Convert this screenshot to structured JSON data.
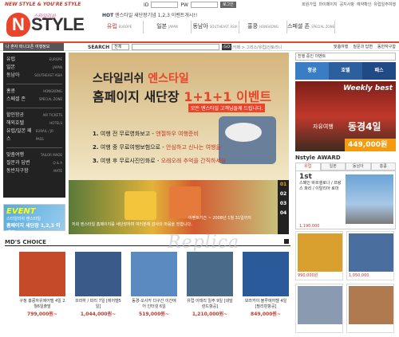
{
  "header": {
    "tagline": "NEW STYLE & YOU'RE STYLE",
    "id_label": "ID",
    "pw_label": "PW",
    "login_button": "로그인",
    "top_links": [
      "회원가입",
      "마이페이지",
      "공지사항",
      "예약확인",
      "유럽일주여행"
    ],
    "ticker_prefix": "HOT",
    "ticker": "엔스타일 새단장기념 1,2,3 이벤트개시!!"
  },
  "logo": {
    "mark": "N",
    "word": "STYLE",
    "small": "스타일리쉬"
  },
  "nav": {
    "tabs": [
      {
        "label": "유럽",
        "sub": "EUROPE"
      },
      {
        "label": "일본",
        "sub": "JAPAN"
      },
      {
        "label": "동남아",
        "sub": "SOUTHEAST ASIA"
      },
      {
        "label": "홍콩",
        "sub": "HONGKONG"
      },
      {
        "label": "스페셜 존",
        "sub": "SPECIAL ZONE"
      }
    ]
  },
  "searchbar": {
    "side_text": "나 혼자 떠나고픈 여행정보",
    "label": "SEARCH",
    "select": "전체",
    "go": "GO",
    "crumb": "베스트카페 > 그리스/유럽/산토리니",
    "util": [
      "맞춤여행",
      "질문과 답변",
      "동반자구함"
    ]
  },
  "sidebar": {
    "groups": [
      [
        {
          "label": "유럽",
          "sub": "EUROPE"
        },
        {
          "label": "일본",
          "sub": "JAPAN"
        },
        {
          "label": "동남아",
          "sub": "SOUTHEAST ASIA"
        }
      ],
      [
        {
          "label": "홍콩",
          "sub": "HONGKONG"
        },
        {
          "label": "스페셜 존",
          "sub": "SPECIAL ZONE"
        }
      ],
      [
        {
          "label": "할인항공",
          "sub": "AIR TICKETS"
        },
        {
          "label": "해외호텔",
          "sub": "HOTELS"
        },
        {
          "label": "유럽/일본 패스",
          "sub": "EURAIL / JR PASS"
        }
      ],
      [
        {
          "label": "맞춤여행",
          "sub": "TAILOR MADE"
        },
        {
          "label": "질문과 답변",
          "sub": "Q & A"
        },
        {
          "label": "동반자구함",
          "sub": "MATE"
        }
      ]
    ]
  },
  "event_box": {
    "title": "EVENT",
    "line1": "스타일리쉬 엔스타일",
    "line2": "홈페이지 새단장 1,2,3 이벤트"
  },
  "banner": {
    "line1_a": "스타일리쉬 ",
    "line1_b": "엔스타일",
    "line2_a": "홈페이지 새단장 ",
    "line2_b": "1+1+1 이벤트",
    "sub": "모든 엔스타일 고객님들께 드립니다.",
    "items": [
      {
        "num": "1.",
        "a": "여행 전 무료영화보고 - ",
        "b": "앤젤하우 여행준비"
      },
      {
        "num": "2.",
        "a": "여행 중 무료여행보험으로 - ",
        "b": "안심하고 신나는 여행을"
      },
      {
        "num": "3.",
        "a": "여행 후 무료사진인화로 - ",
        "b": "오래오래 추억을 간직하세요"
      }
    ],
    "caption": "저희 엔스타일 홈페이지를 새단장하며 여러분께 감사의 마음을 전합니다.",
    "date": "이벤트기간 ~ 2008년 1월 31일까지",
    "pages": [
      "01",
      "02",
      "03",
      "04"
    ]
  },
  "right": {
    "select": "진행 중인 이벤트",
    "icons": [
      {
        "label": "항공",
        "color": "#3a7dc4"
      },
      {
        "label": "호텔",
        "color": "#2c5f9e"
      },
      {
        "label": "패스",
        "color": "#1f4a85"
      }
    ],
    "weekly": {
      "badge": "Weekly best",
      "w1": "자유여행",
      "w2": "동경4일",
      "w3": "449,000원~"
    },
    "award_title": "Nstyle AWARD",
    "award_tabs": [
      "유럽",
      "일본",
      "동남아",
      "홍콩"
    ],
    "award_text_big": "1st",
    "award_text": "스페인 바르셀로나 / 프랑스 파리 / 이탈리아 로마",
    "award_price": "1,190,000",
    "grid": [
      {
        "label": "990,000원",
        "color": "#d9a030"
      },
      {
        "label": "1,050,000",
        "color": "#4a6e9e"
      },
      {
        "label": "",
        "color": "#8a9ab0"
      },
      {
        "label": "",
        "color": "#b07a50"
      }
    ]
  },
  "md": {
    "title": "MD'S CHOICE",
    "items": [
      {
        "name": "구정 홍콩자유에어텔 4일 2월6일출발",
        "price": "799,000원~",
        "color": "#c44a2a"
      },
      {
        "name": "프라하 / 파리 7일 [에어텔5일]",
        "price": "1,044,000원~",
        "color": "#3a5a8a"
      },
      {
        "name": "동경-오사카 다구간 이간에어 인터넷 6일",
        "price": "519,000원~",
        "color": "#5a8ac0"
      },
      {
        "name": "유럽 이태리 일주 9일 [네덜란드항공]",
        "price": "1,210,000원~",
        "color": "#4a6a8a"
      },
      {
        "name": "보라카이 블루에어텔 4일 [필리핀항공]",
        "price": "849,000원~",
        "color": "#2a5a9a"
      }
    ]
  },
  "watermark": "Replica"
}
